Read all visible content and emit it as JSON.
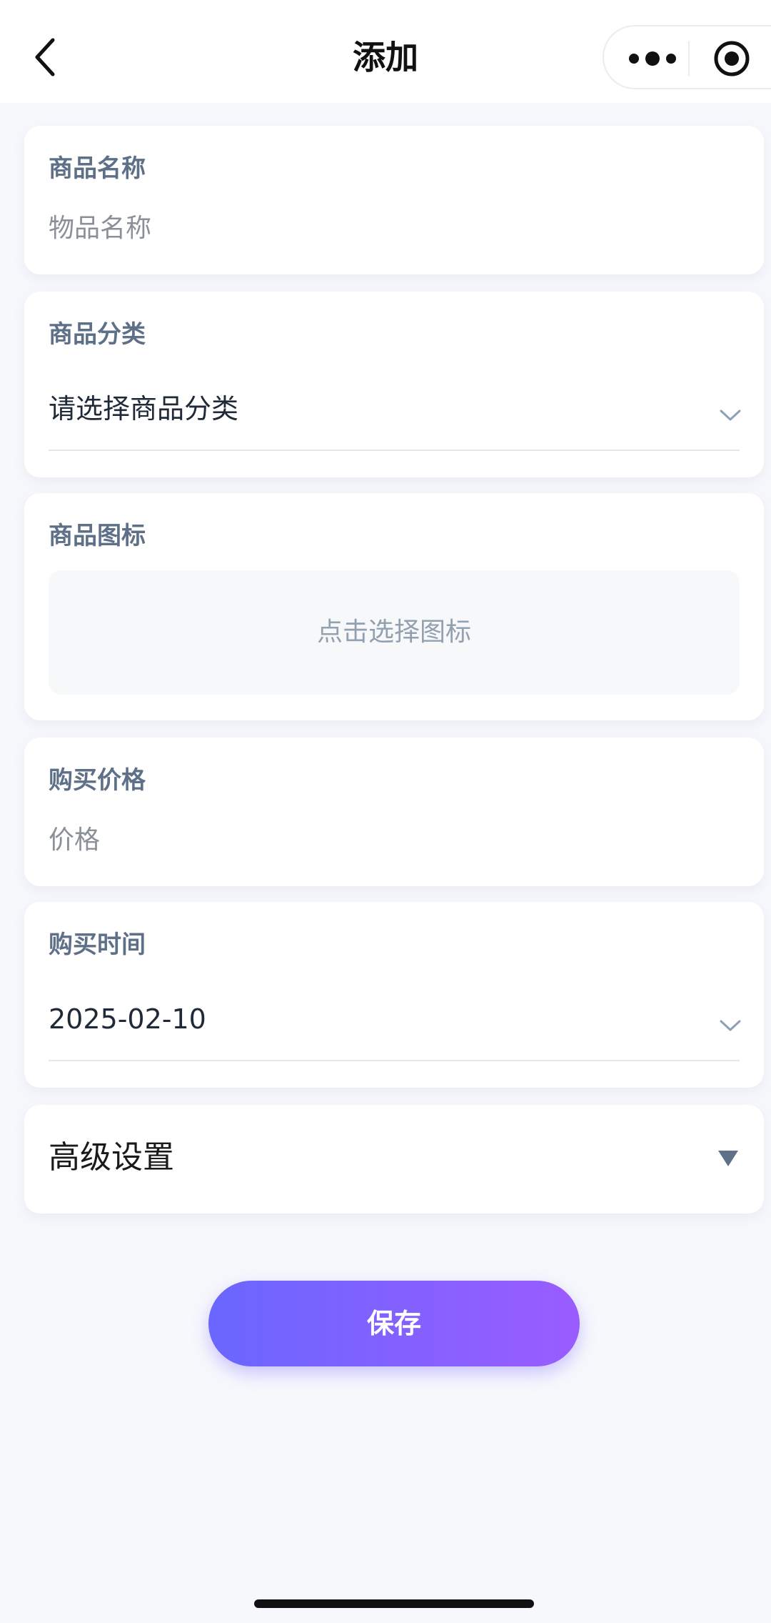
{
  "nav": {
    "title": "添加"
  },
  "form": {
    "name": {
      "label": "商品名称",
      "placeholder": "物品名称"
    },
    "category": {
      "label": "商品分类",
      "value": "请选择商品分类"
    },
    "icon": {
      "label": "商品图标",
      "picker_text": "点击选择图标"
    },
    "price": {
      "label": "购买价格",
      "placeholder": "价格"
    },
    "date": {
      "label": "购买时间",
      "value": "2025-02-10"
    },
    "advanced": {
      "label": "高级设置"
    }
  },
  "save_label": "保存",
  "icons": {
    "back": "chevron-left-icon",
    "more": "more-dots-icon",
    "close": "target-icon",
    "dropdown": "chevron-down-icon",
    "expand": "triangle-down-icon"
  },
  "colors": {
    "accent_start": "#6a66ff",
    "accent_end": "#9a5cff",
    "label": "#5e7088",
    "background": "#f7f8fc"
  }
}
